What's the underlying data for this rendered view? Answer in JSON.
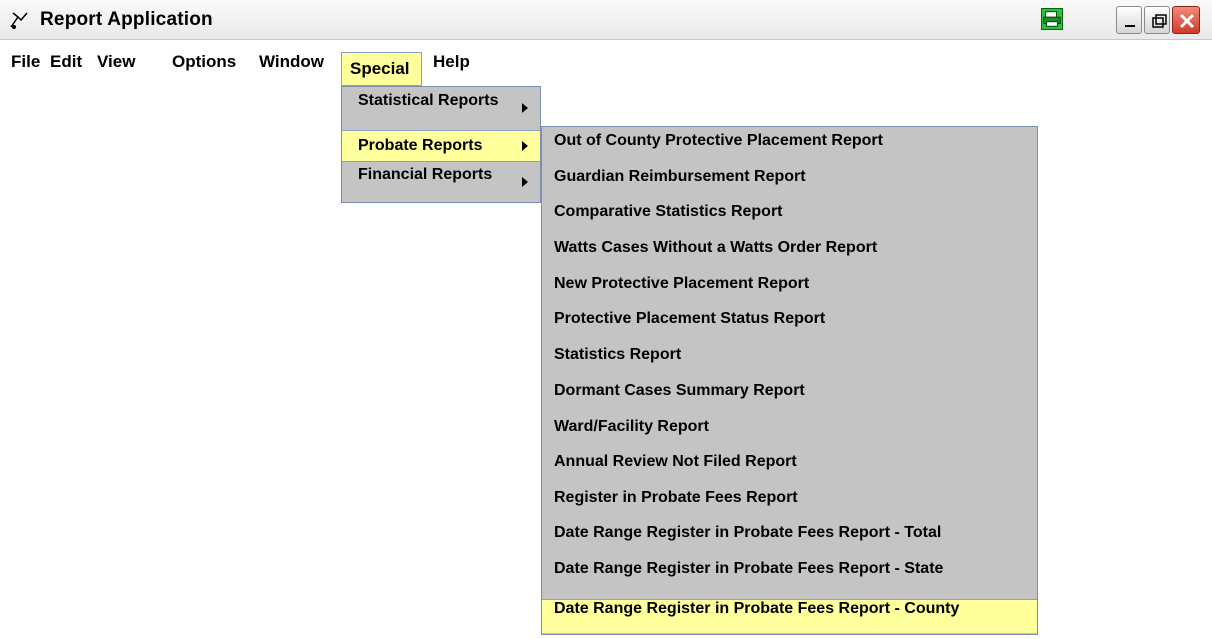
{
  "window": {
    "title": "Report Application",
    "icons": {
      "app": "app-icon",
      "print": "print-icon",
      "minimize": "minimize-icon",
      "maximize": "maximize-icon",
      "close": "close-icon"
    }
  },
  "menubar": {
    "items": [
      {
        "label": "File"
      },
      {
        "label": "Edit"
      },
      {
        "label": "View"
      },
      {
        "label": "Options"
      },
      {
        "label": "Window"
      },
      {
        "label": "Special"
      },
      {
        "label": "Help"
      }
    ],
    "active": "Special"
  },
  "special_menu": {
    "items": [
      {
        "label": "Statistical Reports"
      },
      {
        "label": "Probate Reports"
      },
      {
        "label": "Financial Reports"
      }
    ],
    "active": "Probate Reports"
  },
  "probate_submenu": {
    "items": [
      {
        "label": "Out of County Protective Placement Report"
      },
      {
        "label": "Guardian Reimbursement Report"
      },
      {
        "label": "Comparative Statistics Report"
      },
      {
        "label": "Watts Cases Without a Watts Order Report"
      },
      {
        "label": "New Protective Placement Report"
      },
      {
        "label": "Protective Placement Status Report"
      },
      {
        "label": "Statistics Report"
      },
      {
        "label": "Dormant Cases Summary Report"
      },
      {
        "label": "Ward/Facility Report"
      },
      {
        "label": "Annual Review Not Filed Report"
      },
      {
        "label": "Register in Probate Fees Report"
      },
      {
        "label": "Date Range Register in Probate Fees Report - Total"
      },
      {
        "label": "Date Range Register in Probate Fees Report - State"
      },
      {
        "label": "Date Range Register in Probate Fees Report - County"
      }
    ],
    "active": "Date Range Register in Probate Fees Report - County"
  },
  "colors": {
    "highlight": "#ffff9c",
    "menu_bg": "#c4c4c4",
    "menu_border": "#7c8fb3"
  }
}
